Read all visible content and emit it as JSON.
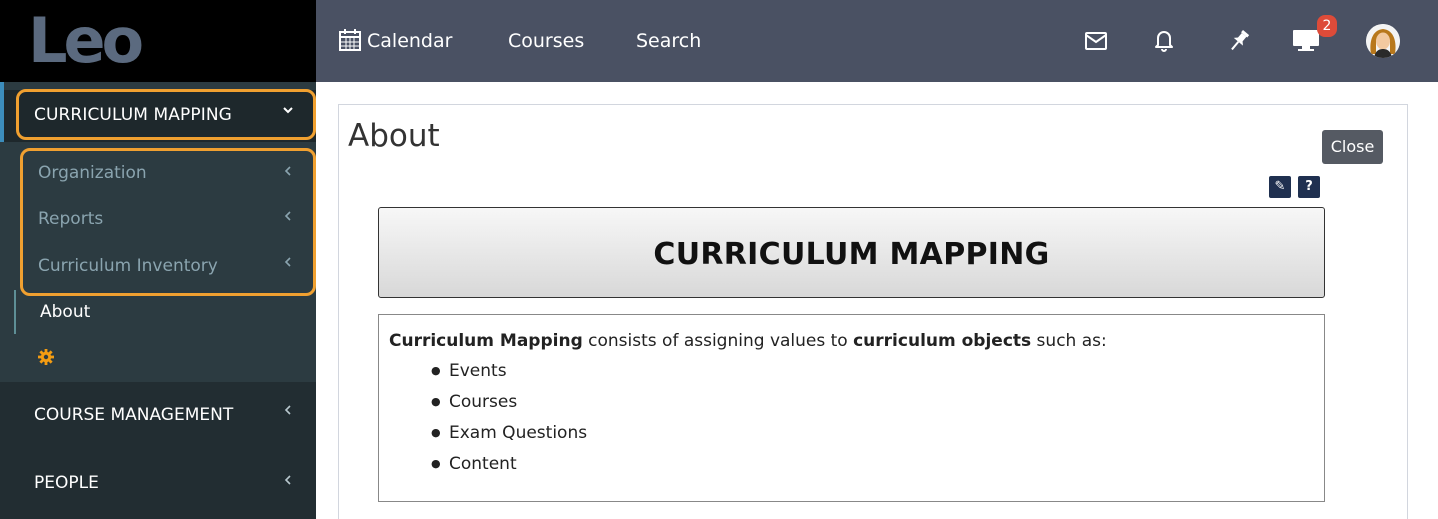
{
  "logo": {
    "text": "Leo"
  },
  "topnav": {
    "calendar_label": "Calendar",
    "courses_label": "Courses",
    "search_label": "Search",
    "notifications_badge": "2"
  },
  "sidebar": {
    "curriculum_mapping": {
      "label": "CURRICULUM MAPPING"
    },
    "sub_items": [
      {
        "label": "Organization"
      },
      {
        "label": "Reports"
      },
      {
        "label": "Curriculum Inventory"
      }
    ],
    "about_label": "About",
    "course_management_label": "COURSE MANAGEMENT",
    "people_label": "PEOPLE"
  },
  "content": {
    "page_title": "About",
    "close_label": "Close",
    "edit_icon_label": "✎",
    "help_icon_label": "?",
    "banner_title": "CURRICULUM MAPPING",
    "desc_bold_1": "Curriculum Mapping",
    "desc_text_1": " consists of assigning values to ",
    "desc_bold_2": "curriculum objects",
    "desc_text_2": " such as:",
    "bullets": [
      "Events",
      "Courses",
      "Exam Questions",
      "Content"
    ]
  },
  "colors": {
    "sidebar_bg": "#222d32",
    "topnav_bg": "#4a5163",
    "highlight": "#f0a030",
    "badge": "#dd4b39",
    "gear": "#f39c12"
  },
  "icons": [
    "calendar-icon",
    "mail-icon",
    "bell-icon",
    "pin-icon",
    "monitor-icon",
    "gear-icon",
    "chevron-down-icon",
    "chevron-left-icon",
    "edit-icon",
    "help-icon"
  ]
}
